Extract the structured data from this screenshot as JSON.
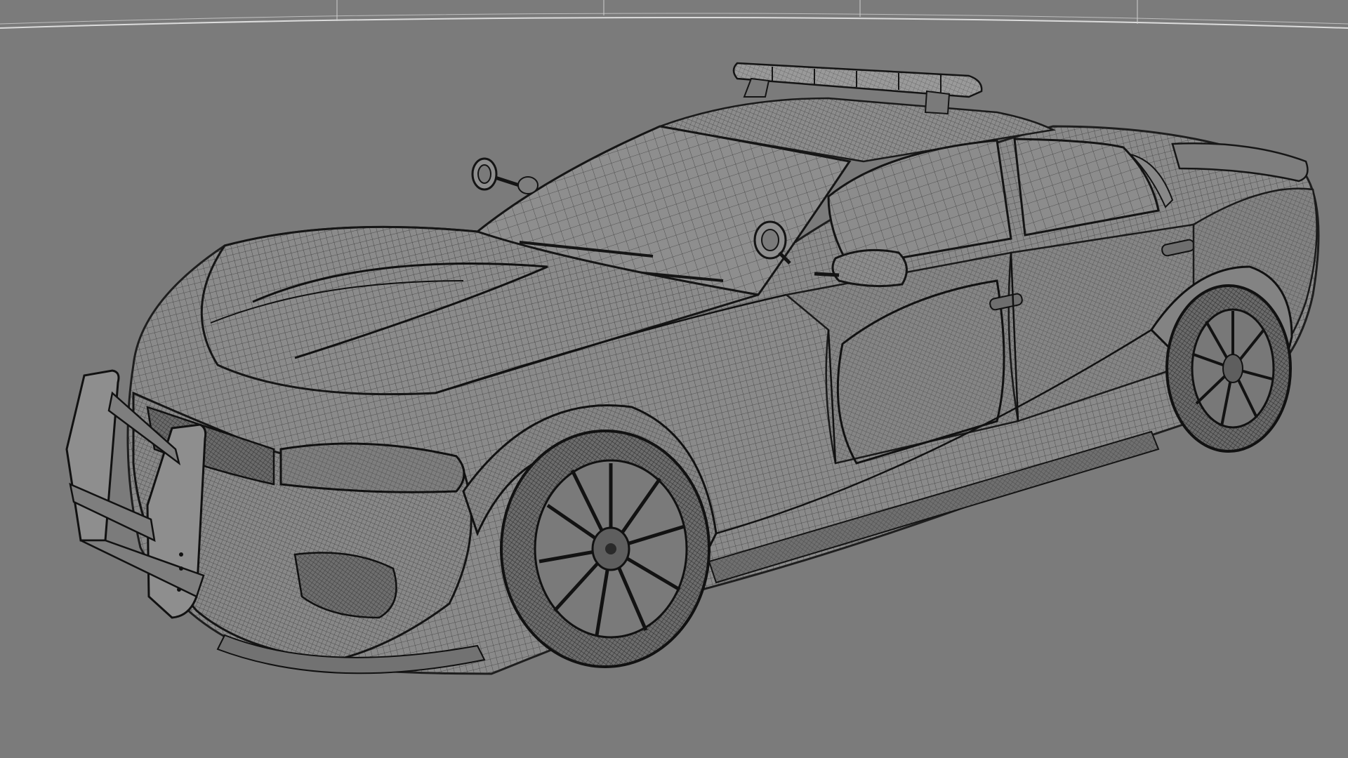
{
  "scene": {
    "background_color": "#7b7b7b",
    "wire_color": "#1e1e1e",
    "surface_color": "#8a8a8a",
    "subject": "police-sedan-wireframe-mesh",
    "parts": [
      "lightbar",
      "roof",
      "windshield",
      "hood",
      "push-bar",
      "front-bumper",
      "headlight",
      "front-wheel",
      "rear-wheel",
      "doors",
      "side-mirror",
      "spotlights",
      "rear-spoiler",
      "side-skirt"
    ]
  }
}
